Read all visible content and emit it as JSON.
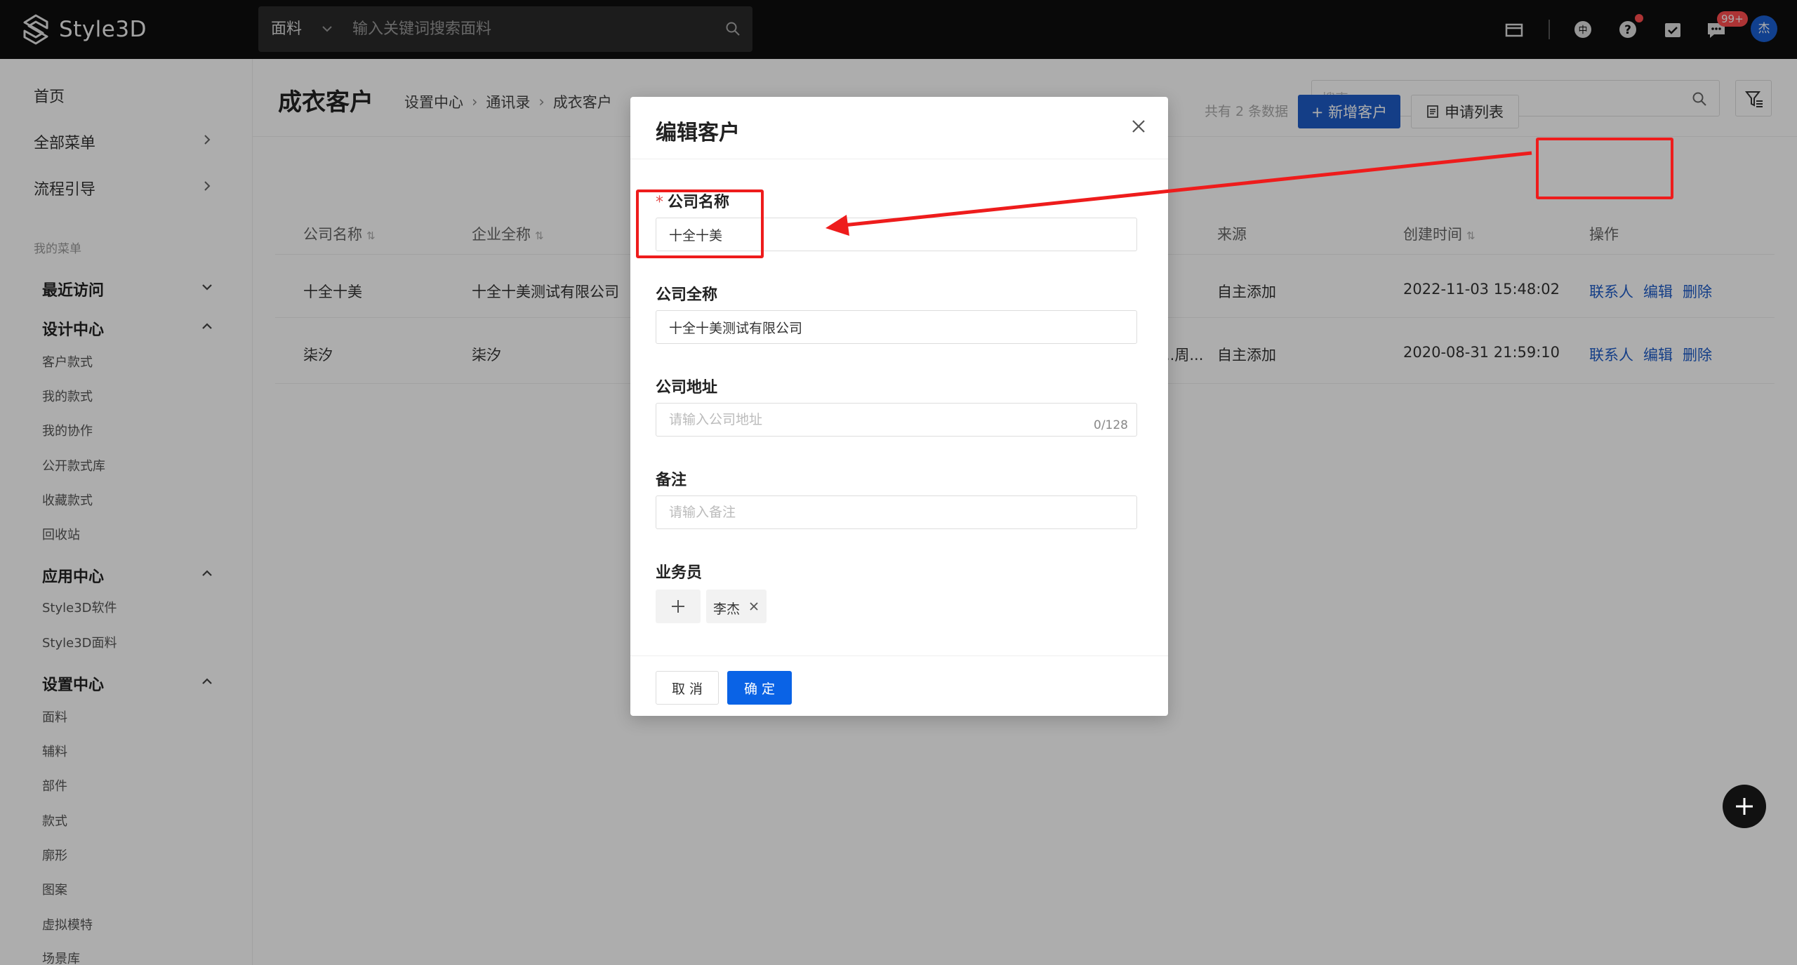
{
  "app": {
    "logo_text": "Style3D",
    "search": {
      "category": "面料",
      "placeholder": "输入关键词搜索面料"
    },
    "badge_count": "99+",
    "avatar": "杰"
  },
  "sidebar": {
    "home": "首页",
    "all_menu": "全部菜单",
    "flow_guide": "流程引导",
    "my_menu": "我的菜单",
    "groups": [
      {
        "label": "最近访问",
        "items": []
      },
      {
        "label": "设计中心",
        "items": [
          "客户款式",
          "我的款式",
          "我的协作",
          "公开款式库",
          "收藏款式",
          "回收站"
        ]
      },
      {
        "label": "应用中心",
        "items": [
          "Style3D软件",
          "Style3D面料"
        ]
      },
      {
        "label": "设置中心",
        "items": [
          "面料",
          "辅料",
          "部件",
          "款式",
          "廓形",
          "图案",
          "虚拟模特",
          "场景库"
        ]
      }
    ]
  },
  "main": {
    "title": "成衣客户",
    "breadcrumb": [
      "设置中心",
      "通讯录",
      "成衣客户"
    ],
    "search_placeholder": "搜索",
    "total_text": "共有 2 条数据",
    "add_button": "+ 新增客户",
    "apply_button": "申请列表",
    "table": {
      "headers": [
        "公司名称",
        "企业全称",
        "来源",
        "创建时间",
        "操作"
      ],
      "rows": [
        {
          "name": "十全十美",
          "full_name": "十全十美测试有限公司",
          "partial": "",
          "source": "自主添加",
          "created": "2022-11-03 15:48:02"
        },
        {
          "name": "柒汐",
          "full_name": "柒汐",
          "partial": "..周...",
          "source": "自主添加",
          "created": "2020-08-31 21:59:10"
        }
      ],
      "ops": [
        "联系人",
        "编辑",
        "删除"
      ]
    }
  },
  "modal": {
    "title": "编辑客户",
    "fields": {
      "company_name": {
        "label": "公司名称",
        "value": "十全十美"
      },
      "company_full": {
        "label": "公司全称",
        "value": "十全十美测试有限公司"
      },
      "company_addr": {
        "label": "公司地址",
        "placeholder": "请输入公司地址",
        "count": "0/128"
      },
      "remark": {
        "label": "备注",
        "placeholder": "请输入备注"
      },
      "staff": {
        "label": "业务员",
        "tag": "李杰"
      }
    },
    "cancel": "取 消",
    "ok": "确 定"
  },
  "colors": {
    "primary": "#1e5cc8",
    "annotation": "#ee1c1c",
    "topbar": "#0e0e0e"
  }
}
